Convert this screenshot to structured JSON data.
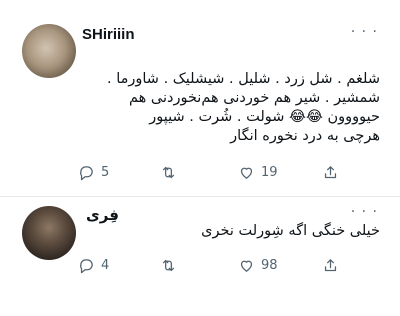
{
  "tweets": [
    {
      "author": "SHiriiin",
      "lines": [
        "شلغم . شل زرد . شلیل . شیشلیک . شاورما .",
        "شمشیر . شیر هم خوردنی هم‌نخوردنی هم",
        "حیوووون 😂😂 شولت . شُرت . شیپور",
        "هرچی به درد نخوره انگار"
      ],
      "reply_count": "5",
      "like_count": "19"
    },
    {
      "author": "فِری",
      "lines": [
        "خیلی خنگی اگه شِورلت نخری"
      ],
      "reply_count": "4",
      "like_count": "98"
    }
  ],
  "icons": {
    "more": "ellipsis-icon",
    "reply": "reply-icon",
    "retweet": "retweet-icon",
    "like": "heart-icon",
    "share": "share-icon"
  },
  "colors": {
    "icon": "#536471",
    "text": "#0f1419",
    "divider": "#e6e9eb"
  }
}
